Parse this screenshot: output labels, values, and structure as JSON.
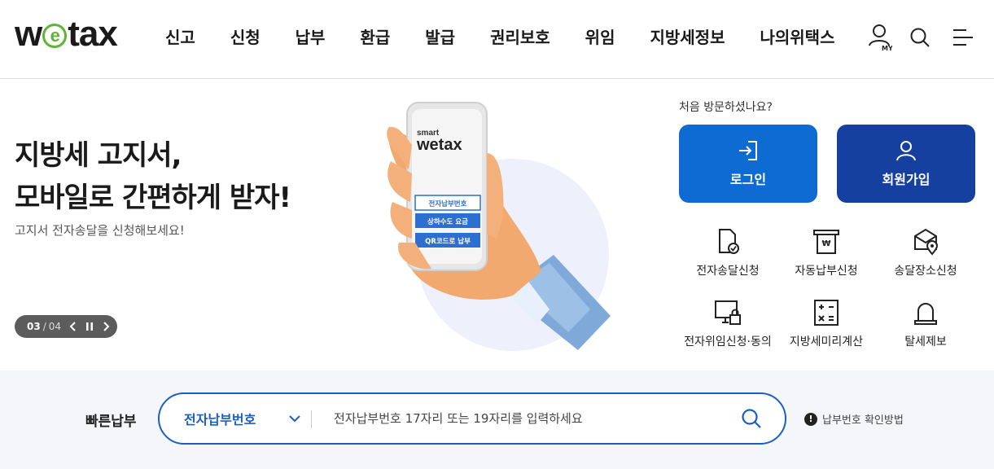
{
  "header": {
    "logo_text": "wetax",
    "nav": [
      "신고",
      "신청",
      "납부",
      "환급",
      "발급",
      "권리보호",
      "위임",
      "지방세정보",
      "나의위택스"
    ],
    "my_badge": "MY"
  },
  "hero": {
    "title_line1": "지방세 고지서,",
    "title_line2": "모바일로 간편하게 받자!",
    "subtitle": "고지서 전자송달을 신청해보세요!",
    "slide_current": "03",
    "slide_sep": "/",
    "slide_total": "04",
    "phone": {
      "brand_small": "smart",
      "brand_logo": "wetax",
      "buttons": [
        "전자납부번호",
        "상하수도 요금",
        "QR코드로 납부"
      ]
    }
  },
  "account": {
    "prompt": "처음 방문하셨나요?",
    "login_label": "로그인",
    "join_label": "회원가입",
    "colors": {
      "login": "#0d6bd1",
      "join": "#1640a0"
    }
  },
  "quick_menu": [
    {
      "label": "전자송달신청",
      "icon": "document-check-icon"
    },
    {
      "label": "자동납부신청",
      "icon": "auto-pay-icon"
    },
    {
      "label": "송달장소신청",
      "icon": "mail-location-icon"
    },
    {
      "label": "전자위임신청·동의",
      "icon": "monitor-lock-icon"
    },
    {
      "label": "지방세미리계산",
      "icon": "calculator-icon"
    },
    {
      "label": "탈세제보",
      "icon": "siren-icon"
    }
  ],
  "quick_pay": {
    "label": "빠른납부",
    "select_value": "전자납부번호",
    "input_placeholder": "전자납부번호 17자리 또는 19자리를 입력하세요",
    "help_text": "납부번호 확인방법",
    "help_mark": "!"
  }
}
